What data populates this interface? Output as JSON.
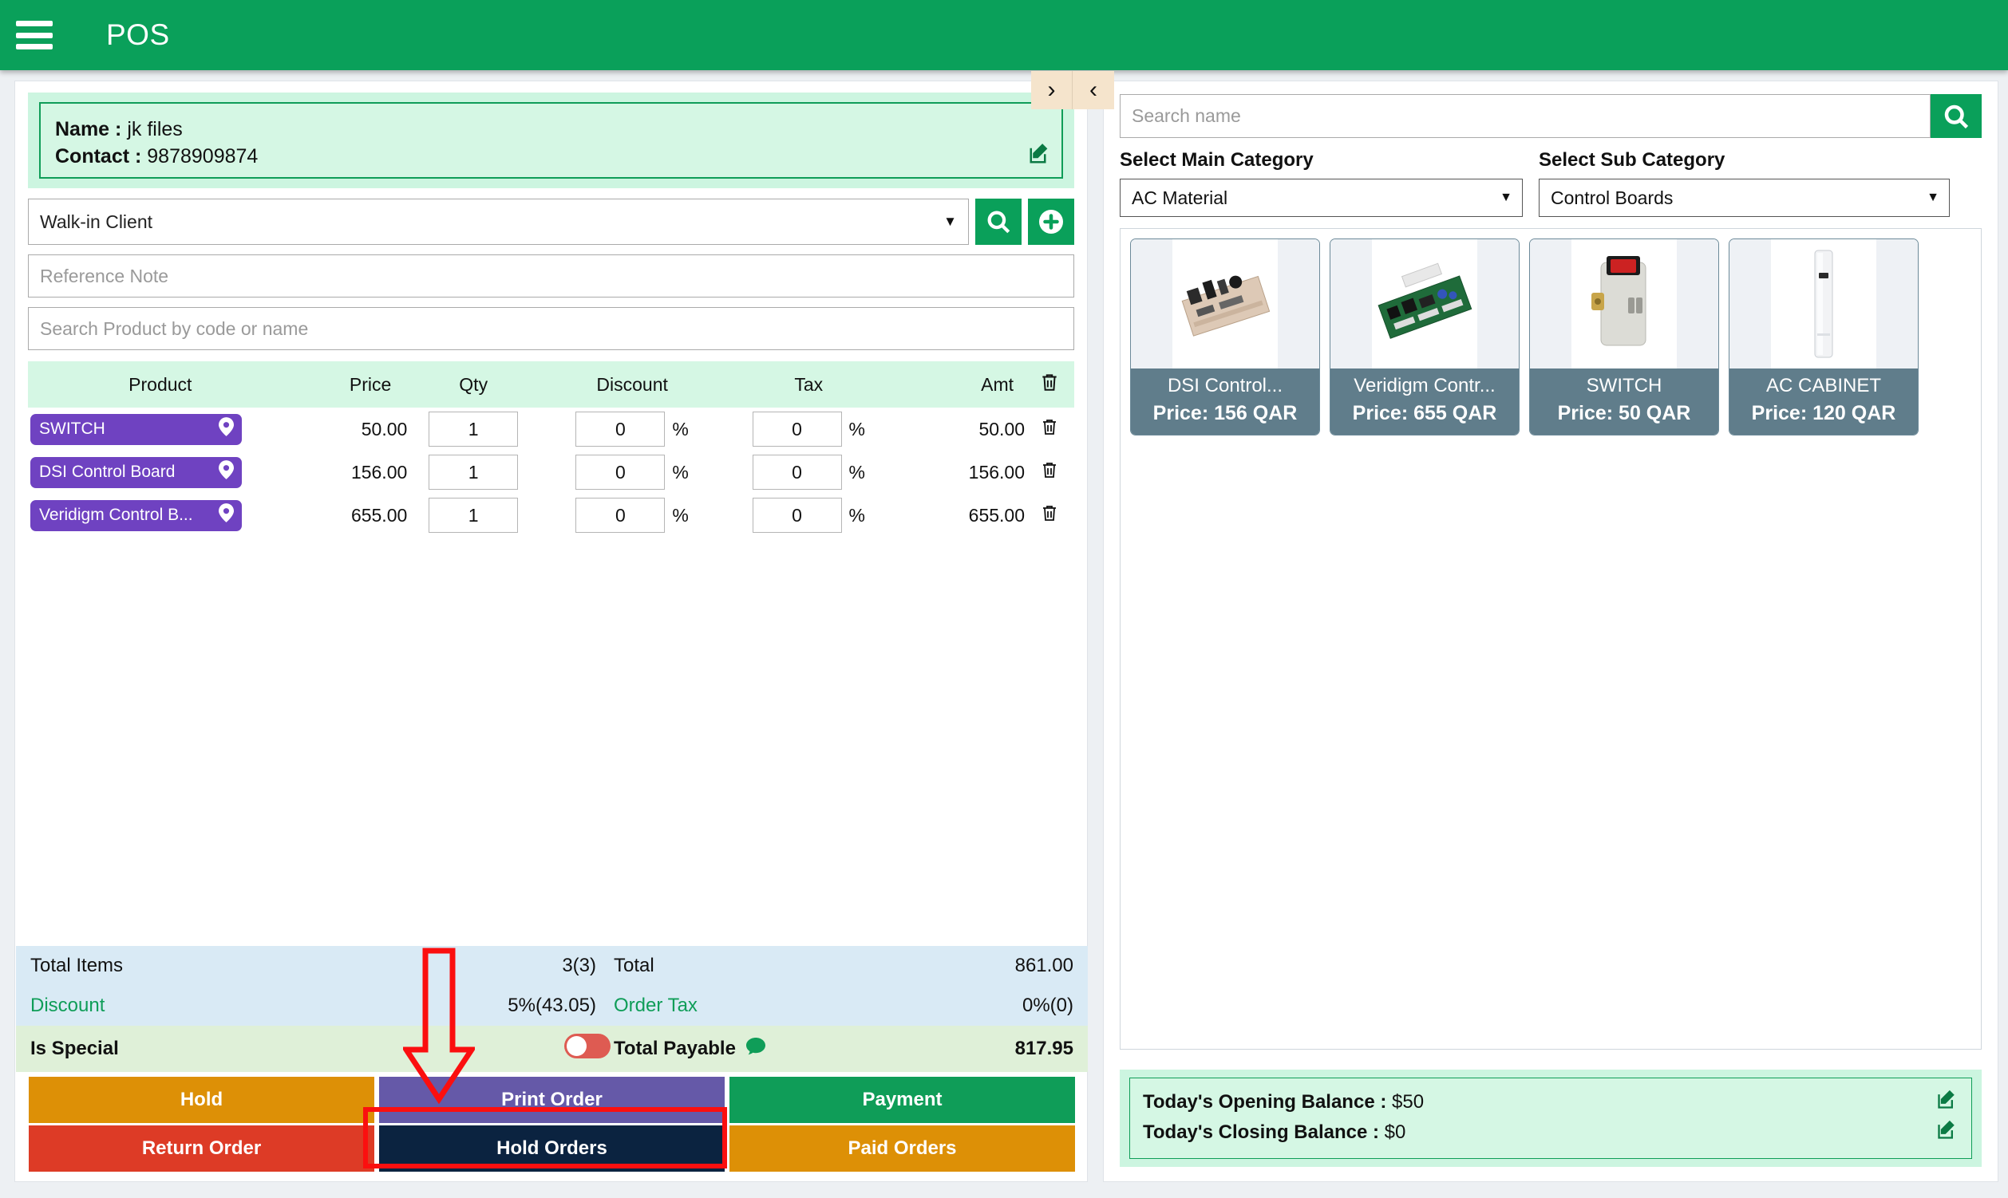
{
  "header": {
    "title": "POS",
    "menu_icon": "hamburger-icon",
    "brand_color": "#0aa05a"
  },
  "collapse": {
    "right_label": "›",
    "left_label": "‹"
  },
  "customer": {
    "name_label": "Name :",
    "name_value": "jk files",
    "contact_label": "Contact :",
    "contact_value": "9878909874",
    "edit_icon": "edit-icon"
  },
  "client_select": {
    "value": "Walk-in Client",
    "caret": "▼",
    "search_icon": "search-icon",
    "add_icon": "plus-circle-icon"
  },
  "reference_note": {
    "placeholder": "Reference Note",
    "value": ""
  },
  "product_search": {
    "placeholder": "Search Product by code or name",
    "value": ""
  },
  "items_table": {
    "headers": [
      "Product",
      "Price",
      "Qty",
      "Discount",
      "Tax",
      "Amt"
    ],
    "delete_header_icon": "trash-icon",
    "rows": [
      {
        "product": "SWITCH",
        "pin_icon": "location-pin-icon",
        "price": "50.00",
        "qty": "1",
        "discount": "0",
        "discount_unit": "%",
        "tax": "0",
        "tax_unit": "%",
        "amount": "50.00",
        "delete_icon": "trash-icon"
      },
      {
        "product": "DSI Control Board",
        "pin_icon": "location-pin-icon",
        "price": "156.00",
        "qty": "1",
        "discount": "0",
        "discount_unit": "%",
        "tax": "0",
        "tax_unit": "%",
        "amount": "156.00",
        "delete_icon": "trash-icon"
      },
      {
        "product": "Veridigm Control B...",
        "pin_icon": "location-pin-icon",
        "price": "655.00",
        "qty": "1",
        "discount": "0",
        "discount_unit": "%",
        "tax": "0",
        "tax_unit": "%",
        "amount": "655.00",
        "delete_icon": "trash-icon"
      }
    ]
  },
  "totals": {
    "total_items_label": "Total Items",
    "total_items_value": "3(3)",
    "total_label": "Total",
    "total_value": "861.00",
    "discount_label": "Discount",
    "discount_value": "5%(43.05)",
    "order_tax_label": "Order Tax",
    "order_tax_value": "0%(0)",
    "is_special_label": "Is Special",
    "is_special_on": false,
    "total_payable_label": "Total Payable",
    "total_payable_icon": "chat-bubble-icon",
    "total_payable_value": "817.95"
  },
  "actions": {
    "hold": "Hold",
    "print_order": "Print Order",
    "payment": "Payment",
    "return_order": "Return Order",
    "hold_orders": "Hold Orders",
    "paid_orders": "Paid Orders"
  },
  "right": {
    "search": {
      "placeholder": "Search name",
      "value": "",
      "button_icon": "search-icon"
    },
    "main_category_label": "Select Main Category",
    "sub_category_label": "Select Sub Category",
    "main_category_value": "AC Material",
    "sub_category_value": "Control Boards",
    "caret": "▼",
    "products": [
      {
        "name": "DSI Control...",
        "price": "Price: 156 QAR",
        "image": "circuit-board-image"
      },
      {
        "name": "Veridigm Contr...",
        "price": "Price: 655 QAR",
        "image": "green-circuit-board-image"
      },
      {
        "name": "SWITCH",
        "price": "Price: 50 QAR",
        "image": "rocker-switch-image"
      },
      {
        "name": "AC CABINET",
        "price": "Price: 120 QAR",
        "image": "ac-cabinet-image"
      }
    ],
    "balance": {
      "opening_label": "Today's Opening Balance :",
      "opening_value": "$50",
      "closing_label": "Today's Closing Balance :",
      "closing_value": "$0",
      "edit_icon": "edit-icon"
    }
  },
  "annotation": {
    "highlight_target": "hold-orders-button",
    "color": "#fb0f0f"
  }
}
